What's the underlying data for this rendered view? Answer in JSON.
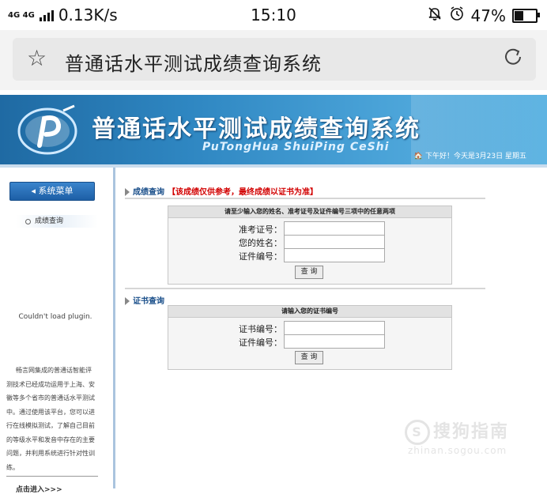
{
  "status_bar": {
    "network": "4G 4G",
    "speed": "0.13K/s",
    "time": "15:10",
    "battery_pct": "47%",
    "battery_level": 0.47
  },
  "browser": {
    "page_title": "普通话水平测试成绩查询系统",
    "star_icon": "star-outline-icon",
    "refresh_icon": "refresh-icon"
  },
  "site": {
    "title": "普通话水平测试成绩查询系统",
    "subtitle": "PuTongHua ShuiPing CeShi",
    "greeting": "下午好！今天是3月23日 星期五",
    "brand_color": "#2f87c2"
  },
  "sidebar": {
    "menu_label": "系统菜单",
    "items": [
      {
        "label": "成绩查询"
      }
    ],
    "plugin_error": "Couldn't load plugin.",
    "promo_text": "畅言网集成的普通话智能评测技术已经成功运用于上海、安徽等多个省市的普通话水平测试中。通过使用该平台，您可以进行在线模拟测试，了解自己目前的等级水平和发音中存在的主要问题，并利用系统进行针对性训练。",
    "more_label": "点击进入>>>"
  },
  "score_query": {
    "section_title": "成绩查询",
    "notice": "【该成绩仅供参考，最终成绩以证书为准】",
    "panel_header": "请至少输入您的姓名、准考证号及证件编号三项中的任意两项",
    "fields": [
      {
        "label": "准考证号：",
        "value": ""
      },
      {
        "label": "您的姓名：",
        "value": ""
      },
      {
        "label": "证件编号：",
        "value": ""
      }
    ],
    "button": "查 询"
  },
  "cert_query": {
    "section_title": "证书查询",
    "panel_header": "请输入您的证书编号",
    "fields": [
      {
        "label": "证书编号：",
        "value": ""
      },
      {
        "label": "证件编号：",
        "value": ""
      }
    ],
    "button": "查 询"
  },
  "watermark": {
    "line1": "搜狗指南",
    "line2": "zhinan.sogou.com"
  }
}
